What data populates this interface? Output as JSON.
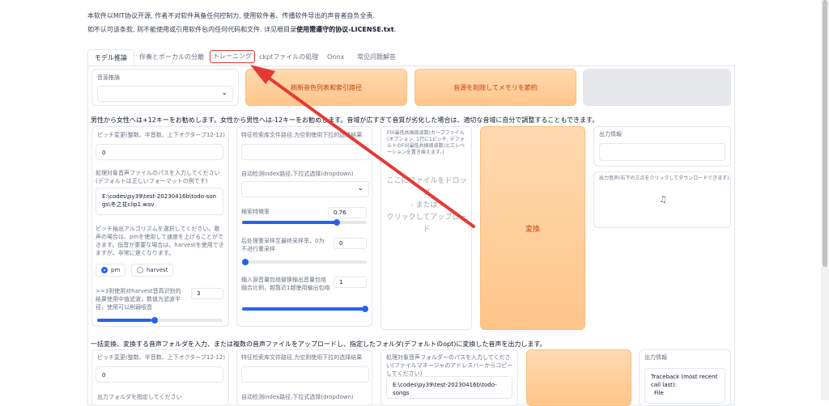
{
  "notice": {
    "line1": "本软件以MIT协议开源, 作者不对软件具备任何控制力, 使用软件者、传播软件导出的声音者自负全责.",
    "line2_prefix": "如不认可该条款, 则不能使用或引用软件包内任何代码和文件. 详见根目录",
    "line2_bold": "使用需遵守的协议-LICENSE.txt",
    "line2_suffix": "."
  },
  "tabs": [
    {
      "label": "モデル推論"
    },
    {
      "label": "伴奏とボーカルの分離"
    },
    {
      "label": "トレーニング"
    },
    {
      "label": "ckptファイルの処理"
    },
    {
      "label": "Onnx"
    },
    {
      "label": "常见问题解答"
    }
  ],
  "inference": {
    "model_label": "音源推論",
    "refresh_button": "刷新音色列表和索引路径",
    "unload_button": "音源を削除してメモリを節約",
    "pitch_hint": "男性から女性へは+12キーをお勧めします。女性から男性へは-12キーをお勧めします。音域が広すぎて音質が劣化した場合は、適切な音域に自分で調整することもできます。",
    "pitch_label": "ピッチ変更(整数、半音数、上下オクターブ12-12)",
    "pitch_value": "0",
    "audio_path_label": "処理対象音声ファイルのパスを入力してください(デフォルトは正しいフォーマットの例です)",
    "audio_path_value": "E:\\codes\\py39\\test-20230416b\\todo-songs\\冬之花clip1.wav",
    "f0_label": "ピッチ抽出アルゴリズムを選択してください。歌声の場合は、pmを使用して速度を上げることができます。低音が重要な場合は、harvestを使用できますが、非常に遅くなります。",
    "f0_opt1": "pm",
    "f0_opt2": "harvest",
    "filter_label": ">=3则使用对harvest音高识别的结果使用中值滤波，数值为滤波半径，使用可以削弱哑音",
    "filter_value": "3",
    "feature_label": "特征检索库文件路径,为空则使用下拉的选择结果",
    "index_label": "自动检测index路径,下拉式选择(dropdown)",
    "ratio_label": "検索特徴率",
    "ratio_value": "0.76",
    "ratio_frac": 0.76,
    "resample_label": "后处理重采样至最终采样率，0为不进行重采样",
    "resample_value": "0",
    "rms_label": "输入源音量包络替换输出音量包络融合比例，越靠近1越使用输出包络",
    "rms_value": "1",
    "f0file_label": "F0(最低共振周波数)カーブファイル(オプション, 1行に1ピッチ, デフォルトのF0(最低共振周波数)とエレベーションを置き換えます。)",
    "drop_text1": "ここにファイルをドロップ",
    "drop_text2": "- または -",
    "drop_text3": "クリックしてアップロード",
    "convert_button": "変換",
    "output_info_label": "出力情報",
    "output_audio_label": "出力音声(右下の三点をクリックしてダウンロードできます)",
    "music_icon": "♫"
  },
  "batch": {
    "hint": "一括変換、変換する音声フォルダを入力、または複数の音声ファイルをアップロードし、指定したフォルダ(デフォルトのopt)に変換した音声を出力します。",
    "pitch_label": "ピッチ変更(整数、半音数、上下オクターブ12-12)",
    "pitch_value": "0",
    "output_folder_label": "出力フォルダを指定してください",
    "feature_label": "特征检索库文件路径,为空则使用下拉的选择结果",
    "index_label": "自动检测index路径,下拉式选择(dropdown)",
    "folder_label": "処理対象音声フォルダーのパスを入力してください(ファイルマネージャのアドレスバーからコピーしてください)",
    "folder_value": "E:\\codes\\py39\\test-20230416b\\todo-songs",
    "output_info_label": "出力情報",
    "traceback": "Traceback (most recent call last):",
    "traceback2": "File"
  },
  "colors": {
    "accent": "#2563eb",
    "orange": "#ffc58a",
    "annotation": "#e53935"
  }
}
